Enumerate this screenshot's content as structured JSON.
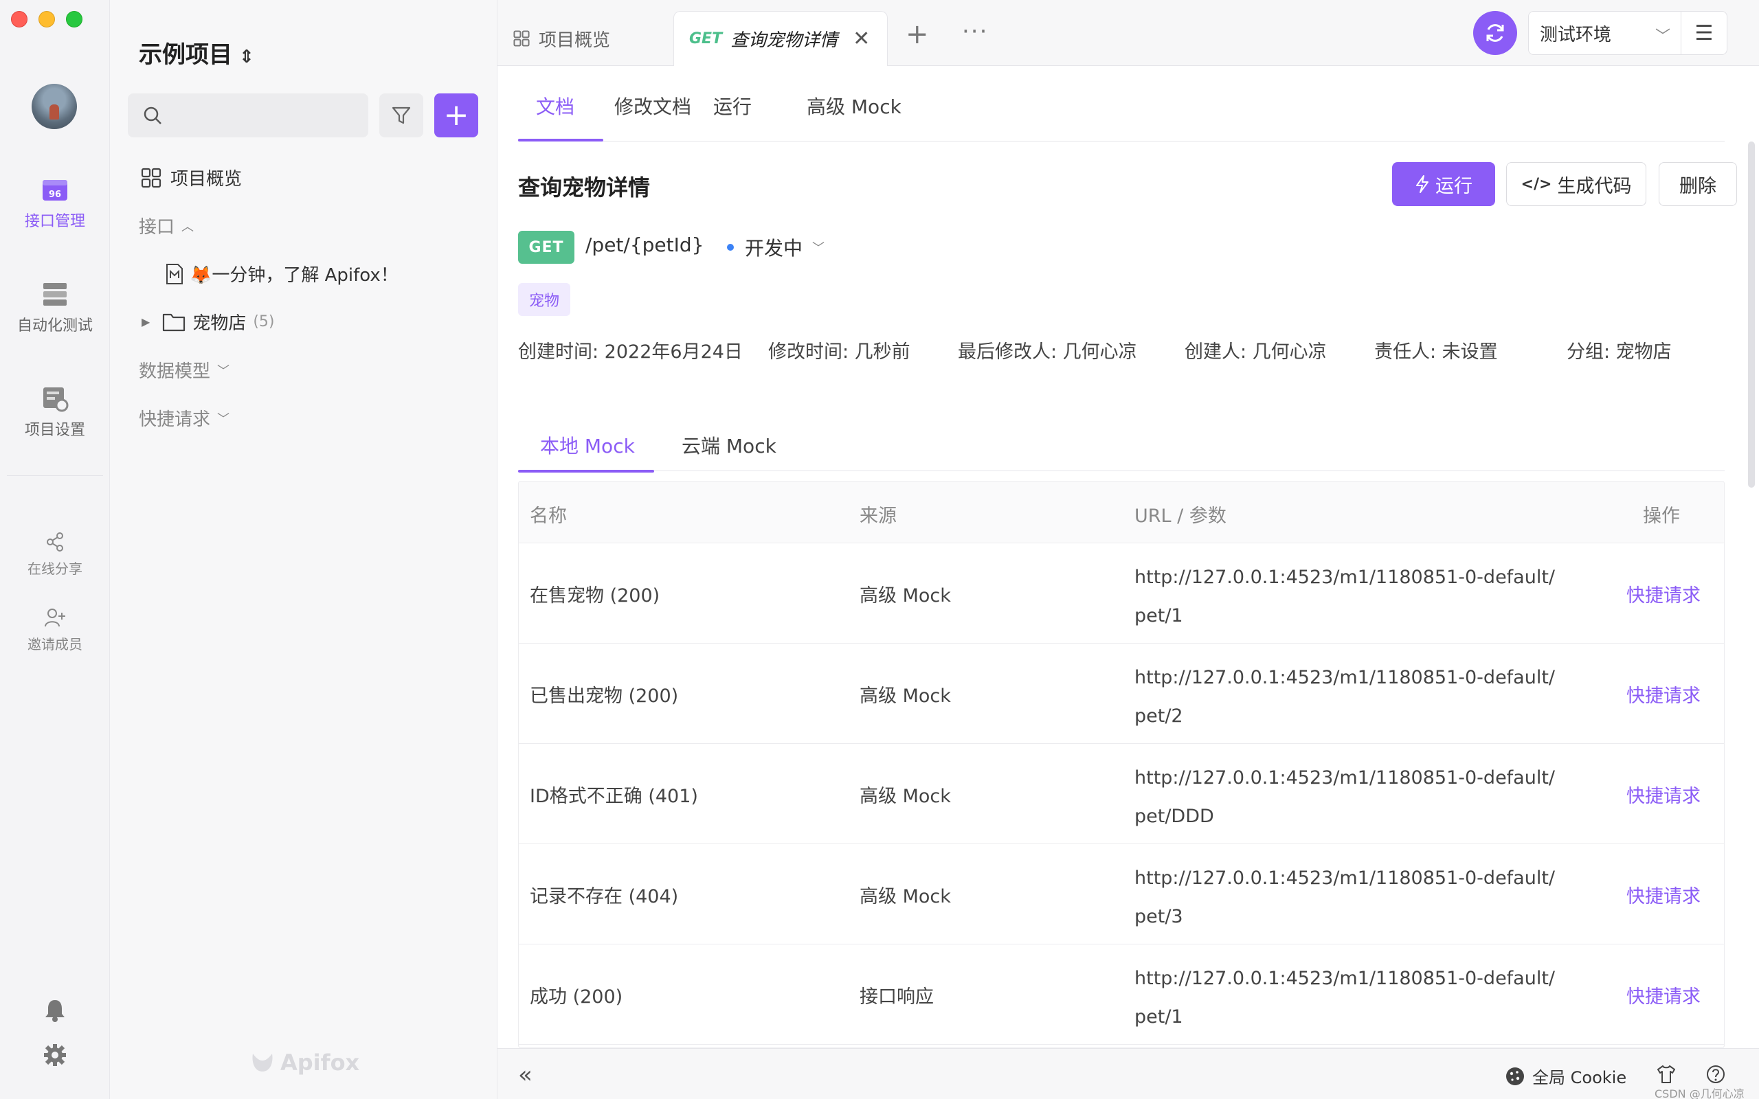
{
  "rail": {
    "items": [
      {
        "label": "接口管理",
        "icon": "api-management-icon",
        "active": true
      },
      {
        "label": "自动化测试",
        "icon": "automation-test-icon",
        "active": false
      },
      {
        "label": "项目设置",
        "icon": "project-settings-icon",
        "active": false
      }
    ],
    "share_label": "在线分享",
    "invite_label": "邀请成员"
  },
  "sidebar": {
    "project_title": "示例项目",
    "search_placeholder": "",
    "overview_label": "项目概览",
    "interfaces_label": "接口",
    "doc_item_label": "🦊一分钟，了解 Apifox！",
    "folder_label": "宠物店",
    "folder_count": "(5)",
    "models_label": "数据模型",
    "quick_label": "快捷请求",
    "logo_text": "Apifox"
  },
  "tabs": {
    "overview_label": "项目概览",
    "active_method": "GET",
    "active_label": "查询宠物详情",
    "env_label": "测试环境"
  },
  "subtabs": [
    "文档",
    "修改文档",
    "运行",
    "高级 Mock"
  ],
  "api": {
    "title": "查询宠物详情",
    "run_label": "运行",
    "code_label": "生成代码",
    "delete_label": "删除",
    "method": "GET",
    "path": "/pet/{petId}",
    "status": "开发中",
    "tag": "宠物",
    "meta": [
      "创建时间: 2022年6月24日",
      "修改时间: 几秒前",
      "最后修改人: 几何心凉",
      "创建人: 几何心凉",
      "责任人: 未设置",
      "分组: 宠物店"
    ]
  },
  "mock": {
    "tabs": [
      "本地 Mock",
      "云端 Mock"
    ],
    "columns": [
      "名称",
      "来源",
      "URL / 参数",
      "操作"
    ],
    "rows": [
      {
        "name": "在售宠物 (200)",
        "source": "高级 Mock",
        "url1": "http://127.0.0.1:4523/m1/1180851-0-default/",
        "url2": "pet/1",
        "action": "快捷请求"
      },
      {
        "name": "已售出宠物 (200)",
        "source": "高级 Mock",
        "url1": "http://127.0.0.1:4523/m1/1180851-0-default/",
        "url2": "pet/2",
        "action": "快捷请求"
      },
      {
        "name": "ID格式不正确 (401)",
        "source": "高级 Mock",
        "url1": "http://127.0.0.1:4523/m1/1180851-0-default/",
        "url2": "pet/DDD",
        "action": "快捷请求"
      },
      {
        "name": "记录不存在 (404)",
        "source": "高级 Mock",
        "url1": "http://127.0.0.1:4523/m1/1180851-0-default/",
        "url2": "pet/3",
        "action": "快捷请求"
      },
      {
        "name": "成功 (200)",
        "source": "接口响应",
        "url1": "http://127.0.0.1:4523/m1/1180851-0-default/",
        "url2": "pet/1",
        "action": "快捷请求"
      }
    ]
  },
  "bottom": {
    "cookie_label": "全局 Cookie",
    "watermark": "CSDN @几何心凉"
  },
  "colors": {
    "accent": "#8b5cf6",
    "get_green": "#56c08f",
    "status_blue": "#3b82f6"
  }
}
